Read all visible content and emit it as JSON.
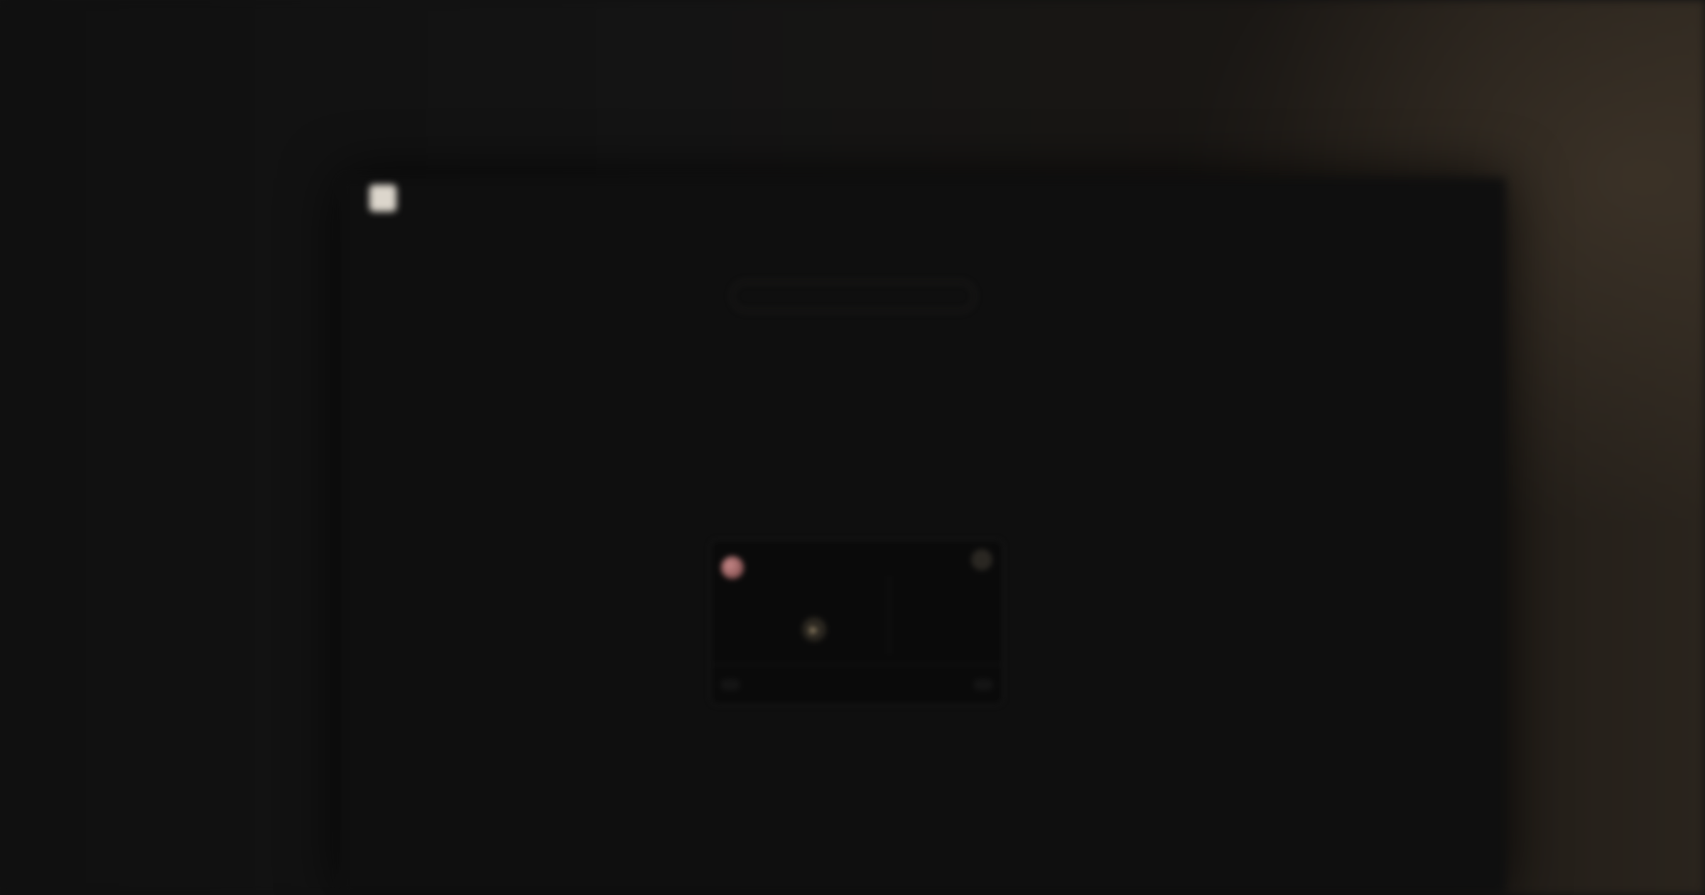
{
  "brand": {
    "logo_letter": "",
    "name": ""
  },
  "hero": {
    "eyebrow": "",
    "headline_line1": "",
    "headline_line2": "",
    "subtitle": "",
    "link": ""
  },
  "player_card": {
    "name": "",
    "col_a": "",
    "col_b": "",
    "badge": "",
    "play_icon": "play-icon",
    "stat_1": "",
    "stat_2": "",
    "chip_left": "",
    "chip_right": ""
  },
  "cta": {
    "title": "",
    "subtitle": ""
  },
  "colors": {
    "background": "#121212",
    "accent": "#c7a070",
    "text": "#e9e2d6"
  }
}
